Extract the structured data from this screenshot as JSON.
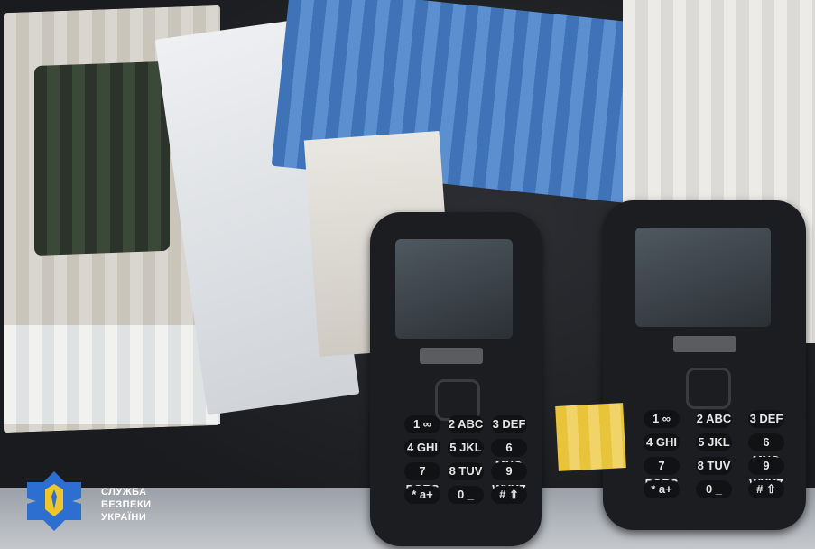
{
  "logo": {
    "lines": [
      "СЛУЖБА",
      "БЕЗПЕКИ",
      "УКРАЇНИ"
    ],
    "shield_color": "#2c6fd1",
    "trident_color": "#f0c62a"
  },
  "phones": [
    {
      "keys": [
        "1 ∞",
        "2 ABC",
        "3 DEF",
        "4 GHI",
        "5 JKL",
        "6 MNO",
        "7 PQRS",
        "8 TUV",
        "9 WXYZ",
        "* a+",
        "0 _",
        "# ⇧"
      ]
    },
    {
      "keys": [
        "1 ∞",
        "2 ABC",
        "3 DEF",
        "4 GHI",
        "5 JKL",
        "6 MNO",
        "7 PQRS",
        "8 TUV",
        "9 WXYZ",
        "* a+",
        "0 _",
        "# ⇧"
      ]
    }
  ],
  "colors": {
    "blue_card": "#4a7fc2",
    "sim_card": "#e8c43a",
    "phone_body": "#1c1d20"
  }
}
